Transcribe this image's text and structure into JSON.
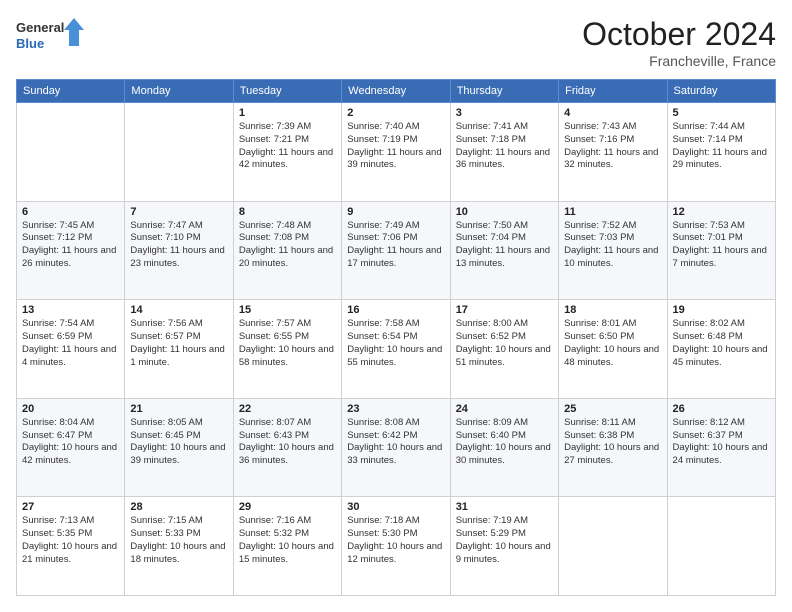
{
  "header": {
    "logo_general": "General",
    "logo_blue": "Blue",
    "month_title": "October 2024",
    "location": "Francheville, France"
  },
  "weekdays": [
    "Sunday",
    "Monday",
    "Tuesday",
    "Wednesday",
    "Thursday",
    "Friday",
    "Saturday"
  ],
  "weeks": [
    [
      {
        "day": "",
        "sunrise": "",
        "sunset": "",
        "daylight": ""
      },
      {
        "day": "",
        "sunrise": "",
        "sunset": "",
        "daylight": ""
      },
      {
        "day": "1",
        "sunrise": "Sunrise: 7:39 AM",
        "sunset": "Sunset: 7:21 PM",
        "daylight": "Daylight: 11 hours and 42 minutes."
      },
      {
        "day": "2",
        "sunrise": "Sunrise: 7:40 AM",
        "sunset": "Sunset: 7:19 PM",
        "daylight": "Daylight: 11 hours and 39 minutes."
      },
      {
        "day": "3",
        "sunrise": "Sunrise: 7:41 AM",
        "sunset": "Sunset: 7:18 PM",
        "daylight": "Daylight: 11 hours and 36 minutes."
      },
      {
        "day": "4",
        "sunrise": "Sunrise: 7:43 AM",
        "sunset": "Sunset: 7:16 PM",
        "daylight": "Daylight: 11 hours and 32 minutes."
      },
      {
        "day": "5",
        "sunrise": "Sunrise: 7:44 AM",
        "sunset": "Sunset: 7:14 PM",
        "daylight": "Daylight: 11 hours and 29 minutes."
      }
    ],
    [
      {
        "day": "6",
        "sunrise": "Sunrise: 7:45 AM",
        "sunset": "Sunset: 7:12 PM",
        "daylight": "Daylight: 11 hours and 26 minutes."
      },
      {
        "day": "7",
        "sunrise": "Sunrise: 7:47 AM",
        "sunset": "Sunset: 7:10 PM",
        "daylight": "Daylight: 11 hours and 23 minutes."
      },
      {
        "day": "8",
        "sunrise": "Sunrise: 7:48 AM",
        "sunset": "Sunset: 7:08 PM",
        "daylight": "Daylight: 11 hours and 20 minutes."
      },
      {
        "day": "9",
        "sunrise": "Sunrise: 7:49 AM",
        "sunset": "Sunset: 7:06 PM",
        "daylight": "Daylight: 11 hours and 17 minutes."
      },
      {
        "day": "10",
        "sunrise": "Sunrise: 7:50 AM",
        "sunset": "Sunset: 7:04 PM",
        "daylight": "Daylight: 11 hours and 13 minutes."
      },
      {
        "day": "11",
        "sunrise": "Sunrise: 7:52 AM",
        "sunset": "Sunset: 7:03 PM",
        "daylight": "Daylight: 11 hours and 10 minutes."
      },
      {
        "day": "12",
        "sunrise": "Sunrise: 7:53 AM",
        "sunset": "Sunset: 7:01 PM",
        "daylight": "Daylight: 11 hours and 7 minutes."
      }
    ],
    [
      {
        "day": "13",
        "sunrise": "Sunrise: 7:54 AM",
        "sunset": "Sunset: 6:59 PM",
        "daylight": "Daylight: 11 hours and 4 minutes."
      },
      {
        "day": "14",
        "sunrise": "Sunrise: 7:56 AM",
        "sunset": "Sunset: 6:57 PM",
        "daylight": "Daylight: 11 hours and 1 minute."
      },
      {
        "day": "15",
        "sunrise": "Sunrise: 7:57 AM",
        "sunset": "Sunset: 6:55 PM",
        "daylight": "Daylight: 10 hours and 58 minutes."
      },
      {
        "day": "16",
        "sunrise": "Sunrise: 7:58 AM",
        "sunset": "Sunset: 6:54 PM",
        "daylight": "Daylight: 10 hours and 55 minutes."
      },
      {
        "day": "17",
        "sunrise": "Sunrise: 8:00 AM",
        "sunset": "Sunset: 6:52 PM",
        "daylight": "Daylight: 10 hours and 51 minutes."
      },
      {
        "day": "18",
        "sunrise": "Sunrise: 8:01 AM",
        "sunset": "Sunset: 6:50 PM",
        "daylight": "Daylight: 10 hours and 48 minutes."
      },
      {
        "day": "19",
        "sunrise": "Sunrise: 8:02 AM",
        "sunset": "Sunset: 6:48 PM",
        "daylight": "Daylight: 10 hours and 45 minutes."
      }
    ],
    [
      {
        "day": "20",
        "sunrise": "Sunrise: 8:04 AM",
        "sunset": "Sunset: 6:47 PM",
        "daylight": "Daylight: 10 hours and 42 minutes."
      },
      {
        "day": "21",
        "sunrise": "Sunrise: 8:05 AM",
        "sunset": "Sunset: 6:45 PM",
        "daylight": "Daylight: 10 hours and 39 minutes."
      },
      {
        "day": "22",
        "sunrise": "Sunrise: 8:07 AM",
        "sunset": "Sunset: 6:43 PM",
        "daylight": "Daylight: 10 hours and 36 minutes."
      },
      {
        "day": "23",
        "sunrise": "Sunrise: 8:08 AM",
        "sunset": "Sunset: 6:42 PM",
        "daylight": "Daylight: 10 hours and 33 minutes."
      },
      {
        "day": "24",
        "sunrise": "Sunrise: 8:09 AM",
        "sunset": "Sunset: 6:40 PM",
        "daylight": "Daylight: 10 hours and 30 minutes."
      },
      {
        "day": "25",
        "sunrise": "Sunrise: 8:11 AM",
        "sunset": "Sunset: 6:38 PM",
        "daylight": "Daylight: 10 hours and 27 minutes."
      },
      {
        "day": "26",
        "sunrise": "Sunrise: 8:12 AM",
        "sunset": "Sunset: 6:37 PM",
        "daylight": "Daylight: 10 hours and 24 minutes."
      }
    ],
    [
      {
        "day": "27",
        "sunrise": "Sunrise: 7:13 AM",
        "sunset": "Sunset: 5:35 PM",
        "daylight": "Daylight: 10 hours and 21 minutes."
      },
      {
        "day": "28",
        "sunrise": "Sunrise: 7:15 AM",
        "sunset": "Sunset: 5:33 PM",
        "daylight": "Daylight: 10 hours and 18 minutes."
      },
      {
        "day": "29",
        "sunrise": "Sunrise: 7:16 AM",
        "sunset": "Sunset: 5:32 PM",
        "daylight": "Daylight: 10 hours and 15 minutes."
      },
      {
        "day": "30",
        "sunrise": "Sunrise: 7:18 AM",
        "sunset": "Sunset: 5:30 PM",
        "daylight": "Daylight: 10 hours and 12 minutes."
      },
      {
        "day": "31",
        "sunrise": "Sunrise: 7:19 AM",
        "sunset": "Sunset: 5:29 PM",
        "daylight": "Daylight: 10 hours and 9 minutes."
      },
      {
        "day": "",
        "sunrise": "",
        "sunset": "",
        "daylight": ""
      },
      {
        "day": "",
        "sunrise": "",
        "sunset": "",
        "daylight": ""
      }
    ]
  ]
}
